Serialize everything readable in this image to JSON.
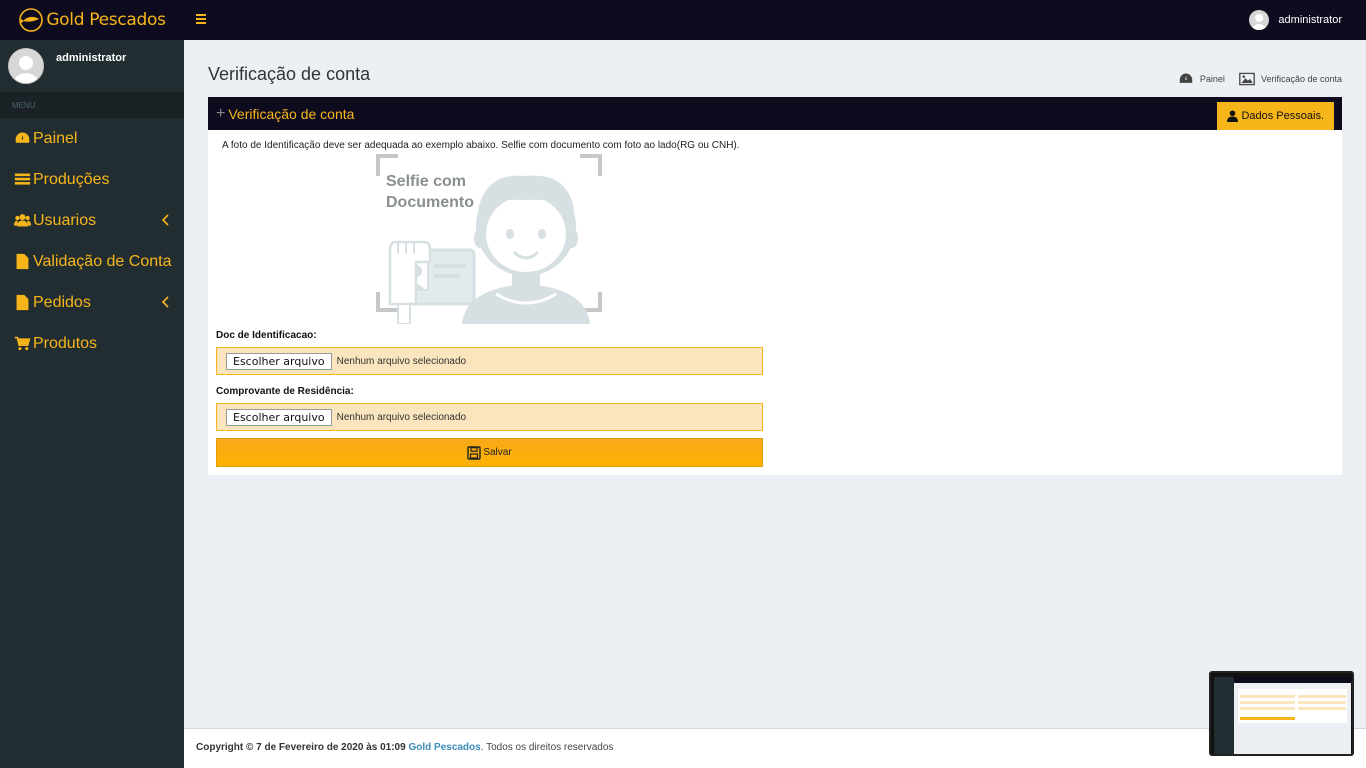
{
  "app": {
    "brand": "Gold Pescados",
    "colors": {
      "accent": "#f6b619",
      "dark": "#0f0b1e",
      "sidebar": "#222d32",
      "link": "#3c8dbc"
    }
  },
  "sidebar": {
    "user_name": "administrator",
    "menu_header": "MENU",
    "items": [
      {
        "label": "Painel",
        "icon": "dashboard-icon"
      },
      {
        "label": "Produções",
        "icon": "list-icon"
      },
      {
        "label": "Usuarios",
        "icon": "users-icon",
        "has_submenu": true
      },
      {
        "label": "Validação de Conta",
        "icon": "file-icon"
      },
      {
        "label": "Pedidos",
        "icon": "file-icon",
        "has_submenu": true
      },
      {
        "label": "Produtos",
        "icon": "cart-icon"
      }
    ]
  },
  "topbar": {
    "user_name": "administrator"
  },
  "page": {
    "title": "Verificação de conta",
    "breadcrumb": [
      {
        "label": "Painel",
        "icon": "dashboard-icon"
      },
      {
        "label": "Verificação de conta",
        "icon": "image-icon"
      }
    ]
  },
  "box": {
    "title": "Verificação de conta",
    "personal_button": "Dados Pessoais.",
    "info": "A foto de Identificação deve ser adequada ao exemplo abaixo. Selfie com documento com foto ao lado(RG ou CNH).",
    "illustration_text_1": "Selfie com",
    "illustration_text_2": "Documento",
    "doc_label": "Doc de Identificacao:",
    "residence_label": "Comprovante de Residência:",
    "file_button": "Escolher arquivo",
    "file_none": "Nenhum arquivo selecionado",
    "save_button": "Salvar"
  },
  "footer": {
    "copyright": "Copyright © 7 de Fevereiro de 2020 às 01:09",
    "brand": "Gold Pescados",
    "rights": ". Todos os direitos reservados"
  }
}
